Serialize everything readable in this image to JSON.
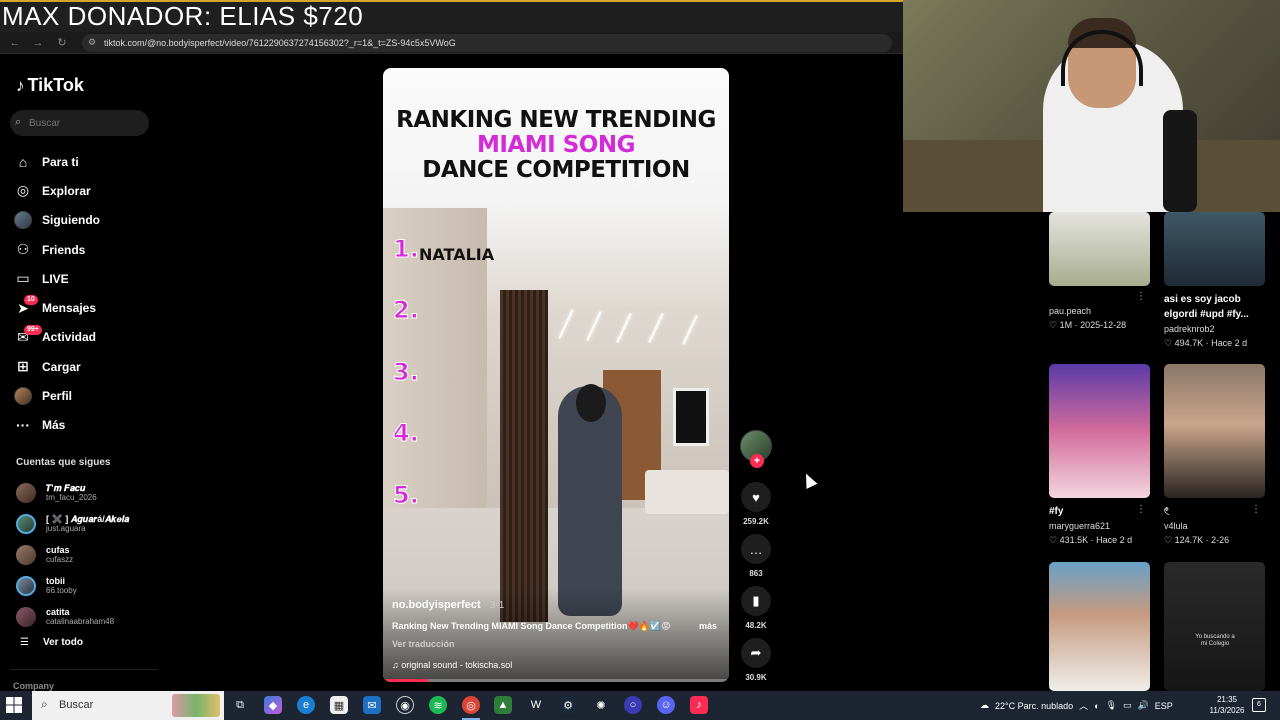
{
  "overlay": {
    "banner": "MAX DONADOR: ELIAS $720"
  },
  "browser": {
    "url": "tiktok.com/@no.bodyisperfect/video/7612290637274156302?_r=1&_t=ZS-94c5x5VWoG"
  },
  "sidebar": {
    "logo": "TikTok",
    "search_placeholder": "Buscar",
    "nav": [
      {
        "label": "Para ti",
        "icon": "home-icon"
      },
      {
        "label": "Explorar",
        "icon": "compass-icon"
      },
      {
        "label": "Siguiendo",
        "icon": "avatar-icon"
      },
      {
        "label": "Friends",
        "icon": "friends-icon"
      },
      {
        "label": "LIVE",
        "icon": "live-icon"
      },
      {
        "label": "Mensajes",
        "icon": "send-icon",
        "badge": "10"
      },
      {
        "label": "Actividad",
        "icon": "inbox-icon",
        "badge": "99+"
      },
      {
        "label": "Cargar",
        "icon": "upload-icon"
      },
      {
        "label": "Perfil",
        "icon": "avatar-icon"
      },
      {
        "label": "Más",
        "icon": "more-icon"
      }
    ],
    "following_title": "Cuentas que sigues",
    "following": [
      {
        "name": "𝑻'𝒎 𝑭𝒂𝒄𝒖",
        "handle": "tm_facu_2026"
      },
      {
        "name": "[ ✖️ ] 𝑨𝒈𝒖𝒂𝒓á/𝑨𝒌𝒆𝒍𝒂",
        "handle": "just.aguara"
      },
      {
        "name": "cufas",
        "handle": "cufaszz"
      },
      {
        "name": "tobii",
        "handle": "66.tooby"
      },
      {
        "name": "catita",
        "handle": "catalinaabraham48"
      }
    ],
    "see_all": "Ver todo",
    "company": "Company"
  },
  "video": {
    "title_line1": "RANKING NEW TRENDING",
    "title_line2": "MIAMI SONG",
    "title_line3": "DANCE COMPETITION",
    "ranks": [
      "1.",
      "2.",
      "3.",
      "4.",
      "5."
    ],
    "rank1_name": "NATALIA",
    "author": "no.bodyisperfect",
    "date": "· 3-1",
    "description": "Ranking New Trending MIAMI Song Dance Competition❤️🔥☑️😡",
    "more": "más",
    "translate": "Ver traducción",
    "sound": "♫  original sound - tokischa.sol",
    "progress": 0.13
  },
  "actions": {
    "likes": "259.2K",
    "comments": "863",
    "saves": "48.2K",
    "shares": "30.9K"
  },
  "grid": [
    {
      "title": "",
      "user": "pau.peach",
      "meta": "♡ 1M · 2025-12-28"
    },
    {
      "title": "asi es soy jacob elgordi #upd #fy...",
      "user": "padreknrob2",
      "meta": "♡ 494.7K · Hace 2 d"
    },
    {
      "title": "#fy",
      "user": "maryguerra621",
      "meta": "♡ 431.5K · Hace 2 d"
    },
    {
      "title": "𓏲",
      "user": "v4lula",
      "meta": "♡ 124.7K · 2-26"
    },
    {
      "title": "",
      "user": "",
      "meta": ""
    },
    {
      "title": "",
      "user": "",
      "meta": "",
      "overlay_text": "Yo buscando a mi Colegio"
    }
  ],
  "taskbar": {
    "search": "Buscar",
    "weather": "22°C  Parc. nublado",
    "lang": "ESP",
    "time": "21:35",
    "date": "11/3/2026",
    "notif": "6"
  }
}
